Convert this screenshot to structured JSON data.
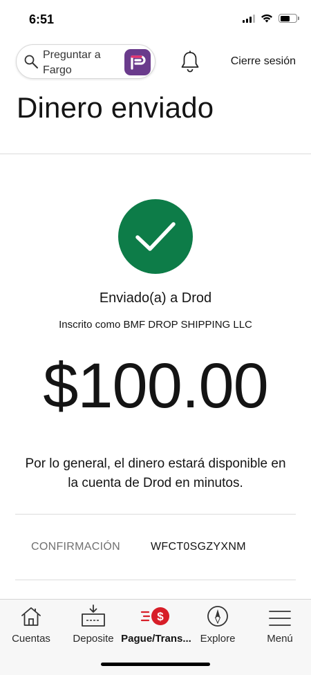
{
  "status_bar": {
    "time": "6:51"
  },
  "header": {
    "search_placeholder": "Preguntar a Fargo",
    "signout_label": "Cierre sesión"
  },
  "page_title": "Dinero enviado",
  "confirmation": {
    "sent_to": "Enviado(a) a Drod",
    "enrolled_as": "Inscrito como BMF DROP SHIPPING LLC",
    "amount": "$100.00",
    "availability_note": "Por lo general, el dinero estará disponible en la cuenta de Drod en minutos.",
    "confirmation_label": "CONFIRMACIÓN",
    "confirmation_number": "WFCT0SGZYXNM"
  },
  "bottom_nav": {
    "items": [
      {
        "label": "Cuentas",
        "icon": "home-icon"
      },
      {
        "label": "Deposite",
        "icon": "deposit-icon"
      },
      {
        "label": "Pague/Trans...",
        "icon": "pay-transfer-icon",
        "active": true
      },
      {
        "label": "Explore",
        "icon": "compass-icon"
      },
      {
        "label": "Menú",
        "icon": "hamburger-menu-icon"
      }
    ]
  },
  "colors": {
    "success_green": "#0d7c48",
    "fargo_purple": "#6a3b8c",
    "accent_red": "#d71e28",
    "muted_text": "#707070"
  }
}
